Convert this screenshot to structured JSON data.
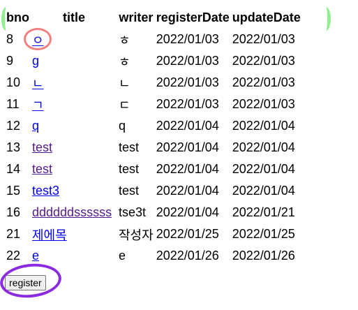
{
  "table": {
    "headers": {
      "bno": "bno",
      "title": "title",
      "writer": "writer",
      "registerDate": "registerDate",
      "updateDate": "updateDate"
    },
    "rows": [
      {
        "bno": "8",
        "title": "ㅇ",
        "writer": "ㅎ",
        "registerDate": "2022/01/03",
        "updateDate": "2022/01/03",
        "visited": false
      },
      {
        "bno": "9",
        "title": "g",
        "writer": "ㅎ",
        "registerDate": "2022/01/03",
        "updateDate": "2022/01/03",
        "visited": false
      },
      {
        "bno": "10",
        "title": "ㄴ",
        "writer": "ㄴ",
        "registerDate": "2022/01/03",
        "updateDate": "2022/01/03",
        "visited": false
      },
      {
        "bno": "11",
        "title": "ㄱ",
        "writer": "ㄷ",
        "registerDate": "2022/01/03",
        "updateDate": "2022/01/03",
        "visited": false
      },
      {
        "bno": "12",
        "title": "q",
        "writer": "q",
        "registerDate": "2022/01/04",
        "updateDate": "2022/01/04",
        "visited": false
      },
      {
        "bno": "13",
        "title": "test",
        "writer": "test",
        "registerDate": "2022/01/04",
        "updateDate": "2022/01/04",
        "visited": true
      },
      {
        "bno": "14",
        "title": "test",
        "writer": "test",
        "registerDate": "2022/01/04",
        "updateDate": "2022/01/04",
        "visited": true
      },
      {
        "bno": "15",
        "title": "test3",
        "writer": "test",
        "registerDate": "2022/01/04",
        "updateDate": "2022/01/04",
        "visited": false
      },
      {
        "bno": "16",
        "title": "ddddddssssss",
        "writer": "tse3t",
        "registerDate": "2022/01/04",
        "updateDate": "2022/01/21",
        "visited": true
      },
      {
        "bno": "21",
        "title": "제에목",
        "writer": "작성자",
        "registerDate": "2022/01/25",
        "updateDate": "2022/01/25",
        "visited": false
      },
      {
        "bno": "22",
        "title": "e",
        "writer": "e",
        "registerDate": "2022/01/26",
        "updateDate": "2022/01/26",
        "visited": false
      }
    ]
  },
  "register_button": {
    "label": "register"
  },
  "colors": {
    "link": "#0000ee",
    "visited_link": "#551a8b",
    "annotation_title_circle": "#f08080",
    "annotation_register_circle": "#8a2be2",
    "annotation_header_brackets": "#90ee90"
  }
}
